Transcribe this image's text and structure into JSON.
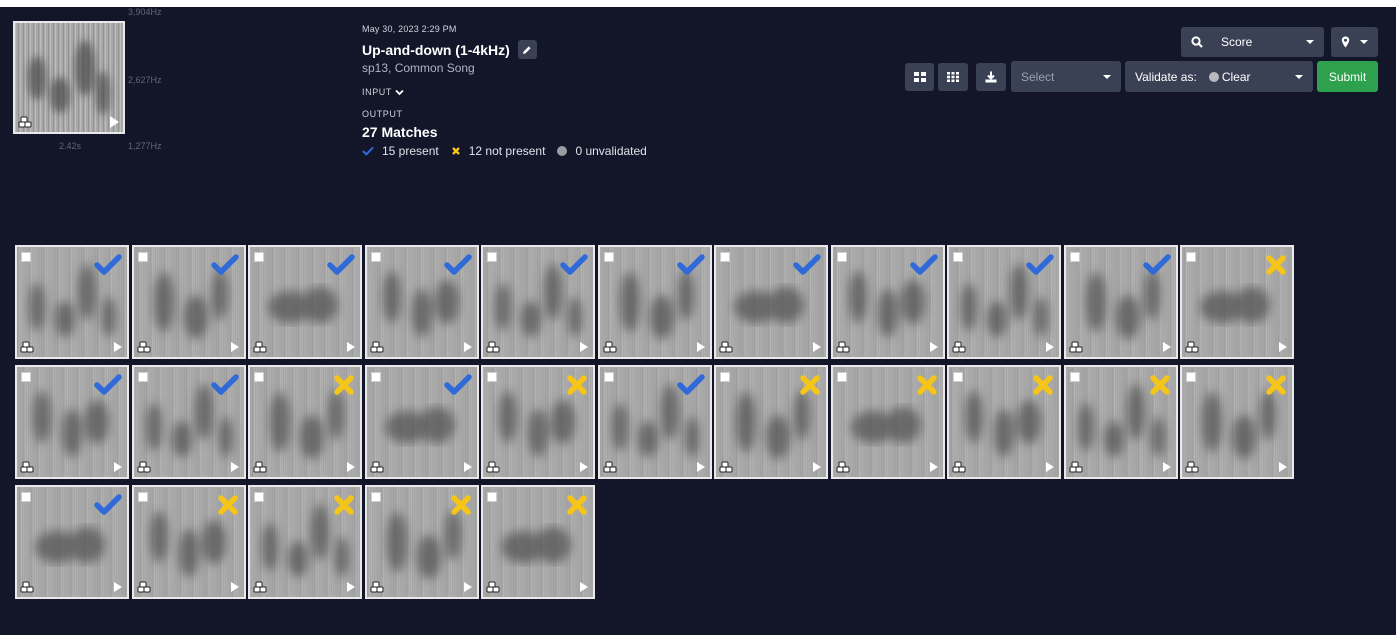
{
  "query": {
    "freq_labels": [
      "3,904Hz",
      "2,627Hz",
      "1,277Hz"
    ],
    "time_label": "2.42s"
  },
  "info": {
    "date": "May 30, 2023 2:29 PM",
    "title": "Up-and-down (1-4kHz)",
    "species": "sp13, Common Song",
    "input_label": "INPUT",
    "output_label": "OUTPUT",
    "matches": "27 Matches",
    "present": "15 present",
    "not_present": "12 not present",
    "unvalidated": "0 unvalidated"
  },
  "toolbar": {
    "score_label": "Score",
    "select_placeholder": "Select",
    "validate_label": "Validate as:",
    "validate_value": "Clear",
    "submit_label": "Submit"
  },
  "colors": {
    "background": "#131628",
    "present": "#2f6ad8",
    "not_present": "#f5c518",
    "submit": "#2ea14e",
    "control": "#3b4155"
  },
  "tiles": [
    {
      "status": "present"
    },
    {
      "status": "present"
    },
    {
      "status": "present"
    },
    {
      "status": "present"
    },
    {
      "status": "present"
    },
    {
      "status": "present"
    },
    {
      "status": "present"
    },
    {
      "status": "present"
    },
    {
      "status": "present"
    },
    {
      "status": "present"
    },
    {
      "status": "not_present"
    },
    {
      "status": "present"
    },
    {
      "status": "present"
    },
    {
      "status": "not_present"
    },
    {
      "status": "present"
    },
    {
      "status": "not_present"
    },
    {
      "status": "present"
    },
    {
      "status": "not_present"
    },
    {
      "status": "not_present"
    },
    {
      "status": "not_present"
    },
    {
      "status": "not_present"
    },
    {
      "status": "not_present"
    },
    {
      "status": "present"
    },
    {
      "status": "not_present"
    },
    {
      "status": "not_present"
    },
    {
      "status": "not_present"
    },
    {
      "status": "not_present"
    }
  ]
}
